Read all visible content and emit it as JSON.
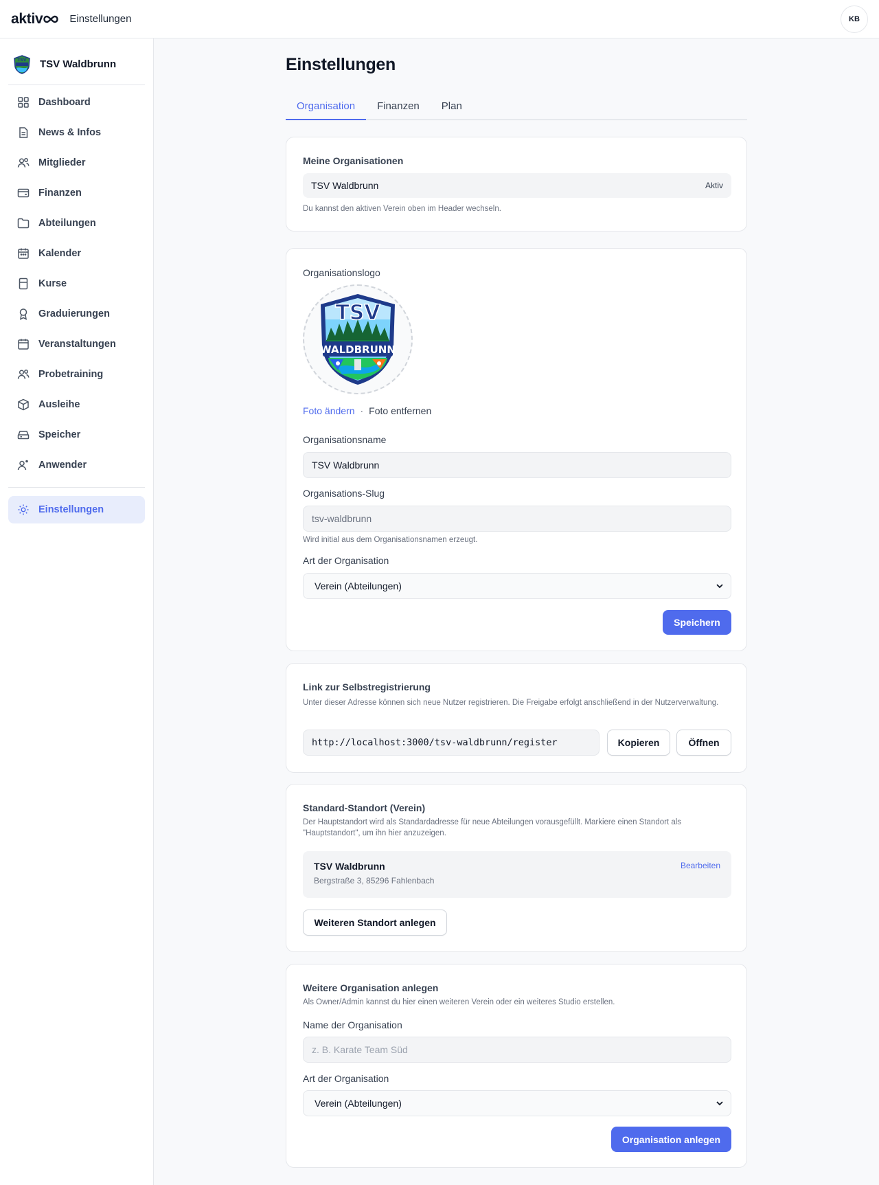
{
  "header": {
    "brand": "aktiv",
    "title": "Einstellungen",
    "avatar_initials": "KB"
  },
  "sidebar": {
    "org_name": "TSV Waldbrunn",
    "items": [
      {
        "label": "Dashboard",
        "icon": "dashboard-icon"
      },
      {
        "label": "News & Infos",
        "icon": "news-icon"
      },
      {
        "label": "Mitglieder",
        "icon": "members-icon"
      },
      {
        "label": "Finanzen",
        "icon": "wallet-icon"
      },
      {
        "label": "Abteilungen",
        "icon": "folder-icon"
      },
      {
        "label": "Kalender",
        "icon": "calendar-icon"
      },
      {
        "label": "Kurse",
        "icon": "course-icon"
      },
      {
        "label": "Graduierungen",
        "icon": "award-icon"
      },
      {
        "label": "Veranstaltungen",
        "icon": "event-calendar-icon"
      },
      {
        "label": "Probetraining",
        "icon": "trial-users-icon"
      },
      {
        "label": "Ausleihe",
        "icon": "package-icon"
      },
      {
        "label": "Speicher",
        "icon": "storage-icon"
      },
      {
        "label": "Anwender",
        "icon": "user-add-icon"
      }
    ],
    "active_item": {
      "label": "Einstellungen",
      "icon": "settings-icon"
    }
  },
  "main": {
    "title": "Einstellungen",
    "tabs": [
      {
        "label": "Organisation",
        "active": true
      },
      {
        "label": "Finanzen",
        "active": false
      },
      {
        "label": "Plan",
        "active": false
      }
    ],
    "my_orgs": {
      "title": "Meine Organisationen",
      "org_name": "TSV Waldbrunn",
      "status": "Aktiv",
      "hint": "Du kannst den aktiven Verein oben im Header wechseln."
    },
    "org_settings": {
      "logo_label": "Organisationslogo",
      "logo_text_top": "TSV",
      "logo_text_bottom": "WALDBRUNN",
      "change_photo": "Foto ändern",
      "separator": "·",
      "remove_photo": "Foto entfernen",
      "name_label": "Organisationsname",
      "name_value": "TSV Waldbrunn",
      "slug_label": "Organisations-Slug",
      "slug_value": "tsv-waldbrunn",
      "slug_hint": "Wird initial aus dem Organisationsnamen erzeugt.",
      "type_label": "Art der Organisation",
      "type_value": "Verein (Abteilungen)",
      "save_label": "Speichern"
    },
    "registration": {
      "title": "Link zur Selbstregistrierung",
      "description": "Unter dieser Adresse können sich neue Nutzer registrieren. Die Freigabe erfolgt anschließend in der Nutzerverwaltung.",
      "url": "http://localhost:3000/tsv-waldbrunn/register",
      "copy_label": "Kopieren",
      "open_label": "Öffnen"
    },
    "location": {
      "title": "Standard-Standort (Verein)",
      "description": "Der Hauptstandort wird als Standardadresse für neue Abteilungen vorausgefüllt. Markiere einen Standort als \"Hauptstandort\", um ihn hier anzuzeigen.",
      "name": "TSV Waldbrunn",
      "address": "Bergstraße 3, 85296 Fahlenbach",
      "edit_label": "Bearbeiten",
      "add_label": "Weiteren Standort anlegen"
    },
    "new_org": {
      "title": "Weitere Organisation anlegen",
      "description": "Als Owner/Admin kannst du hier einen weiteren Verein oder ein weiteres Studio erstellen.",
      "name_label": "Name der Organisation",
      "name_placeholder": "z. B. Karate Team Süd",
      "type_label": "Art der Organisation",
      "type_value": "Verein (Abteilungen)",
      "submit_label": "Organisation anlegen"
    }
  },
  "colors": {
    "accent": "#4f6bed",
    "active_bg": "#e8edfc",
    "field_bg": "#f3f4f6",
    "border": "#e5e7eb"
  }
}
